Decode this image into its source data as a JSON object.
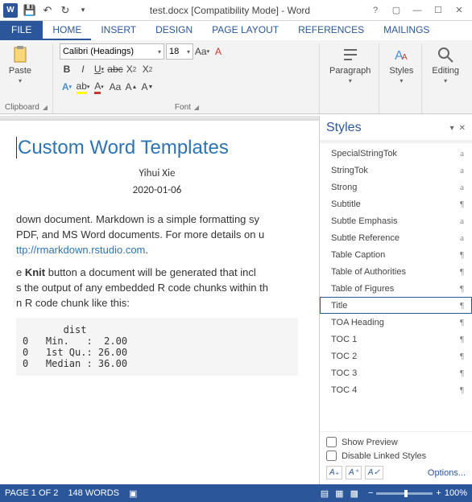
{
  "titlebar": {
    "title": "test.docx [Compatibility Mode] - Word"
  },
  "ribbon": {
    "tabs": {
      "file": "FILE",
      "home": "HOME",
      "insert": "INSERT",
      "design": "DESIGN",
      "pagelayout": "PAGE LAYOUT",
      "references": "REFERENCES",
      "mailings": "MAILINGS"
    },
    "font_name": "Calibri (Headings)",
    "font_size": "18",
    "groups": {
      "clipboard": "Clipboard",
      "font": "Font",
      "paragraph": "Paragraph",
      "styles": "Styles",
      "editing": "Editing"
    },
    "paste_label": "Paste"
  },
  "document": {
    "title": "Custom Word Templates",
    "author": "Yihui Xie",
    "date": "2020-01-06",
    "p1_a": "down document. Markdown is a simple formatting sy",
    "p1_b": " PDF, and MS Word documents. For more details on u",
    "p1_link": "ttp://rmarkdown.rstudio.com",
    "p1_c": ".",
    "p2_a": "e ",
    "p2_b": "Knit",
    "p2_c": " button a document will be generated that incl",
    "p2_d": "s the output of any embedded R code chunks within th",
    "p2_e": "n R code chunk like this:",
    "code": "       dist\n0   Min.   :  2.00\n0   1st Qu.: 26.00\n0   Median : 36.00"
  },
  "styles_pane": {
    "title": "Styles",
    "items": [
      {
        "name": "SpecialStringTok",
        "mark": "a"
      },
      {
        "name": "StringTok",
        "mark": "a"
      },
      {
        "name": "Strong",
        "mark": "a"
      },
      {
        "name": "Subtitle",
        "mark": "¶"
      },
      {
        "name": "Subtle Emphasis",
        "mark": "a"
      },
      {
        "name": "Subtle Reference",
        "mark": "a"
      },
      {
        "name": "Table Caption",
        "mark": "¶"
      },
      {
        "name": "Table of Authorities",
        "mark": "¶"
      },
      {
        "name": "Table of Figures",
        "mark": "¶"
      },
      {
        "name": "Title",
        "mark": "¶"
      },
      {
        "name": "TOA Heading",
        "mark": "¶"
      },
      {
        "name": "TOC 1",
        "mark": "¶"
      },
      {
        "name": "TOC 2",
        "mark": "¶"
      },
      {
        "name": "TOC 3",
        "mark": "¶"
      },
      {
        "name": "TOC 4",
        "mark": "¶"
      }
    ],
    "selected_index": 9,
    "show_preview": "Show Preview",
    "disable_linked": "Disable Linked Styles",
    "options": "Options..."
  },
  "statusbar": {
    "page": "PAGE 1 OF 2",
    "words": "148 WORDS",
    "zoom": "100%"
  }
}
